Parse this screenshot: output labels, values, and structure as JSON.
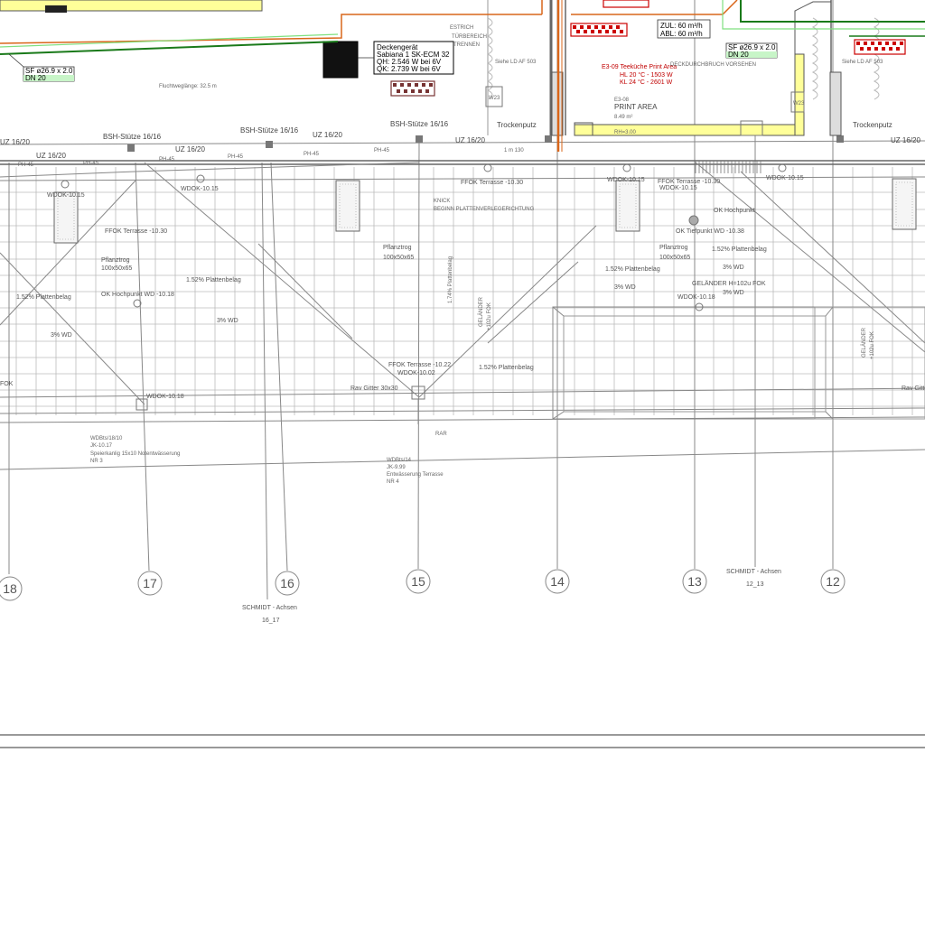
{
  "annotations": {
    "sf_left": "SF ø26.9 x 2.0",
    "dn_left": "DN 20",
    "sf_right": "SF ø26.9 x 2.0",
    "dn_right": "DN 20",
    "fluchtweglaenge": "Fluchtweglänge: 32.5 m",
    "estrich": "ESTRICH",
    "tuerbereich": "TÜRBEREICH",
    "trennen": "TRENNEN",
    "siehe_left": "Siehe LD AF 503",
    "siehe_right": "Siehe LD AF 503",
    "deckengeraet_1": "Deckengerät",
    "deckengeraet_2": "Sabiana 1 SK-ECM 32",
    "deckengeraet_3": "QH: 2.546 W bei 6V",
    "deckengeraet_4": "QK: 2.739 W bei 6V",
    "zul": "ZUL: 60 m³/h",
    "abl": "ABL: 60 m³/h",
    "teekueche_1": "E3-09 Teeküche Print Area",
    "teekueche_2": "HL 20 °C - 1503 W",
    "teekueche_3": "KL 24 °C - 2601 W",
    "deckdurchbruch": "DECKDURCHBRUCH VORSEHEN",
    "room_no": "E3-08",
    "room_name": "PRINT AREA",
    "room_area": "8.49 m²",
    "room_rh": "RH=3.00",
    "trockenputz_left": "Trockenputz",
    "trockenputz_right": "Trockenputz",
    "w23_left": "W23",
    "w23_right": "W23",
    "bsh_1": "BSH-Stütze 16/16",
    "bsh_2": "BSH-Stütze 16/16",
    "bsh_3": "BSH-Stütze 16/16",
    "uz_1": "UZ 16/20",
    "uz_2": "UZ 16/20",
    "uz_3": "UZ 16/20",
    "uz_4": "UZ 16/20",
    "uz_5": "UZ 16/20",
    "uz_6": "UZ 16/20",
    "ph45": "PH-45",
    "wdok_1015": "WDOK-10.15",
    "ffok_1030": "FFOK Terrasse -10.30",
    "knick": "KNICK",
    "beginn": "BEGINN PLATTENVERLEGERICHTUNG",
    "pflanztrog": "Pflanztrog",
    "pflanztrog_dim": "100x50x65",
    "gefaelle_152": "1.52% Plattenbelag",
    "gefaelle_174": "1.74% Plattenbelag",
    "wd_3": "3% WD",
    "ok_tiefpunkt": "OK Tiefpunkt WD -10.38",
    "ok_hochpunkt": "OK Hochpunkt WD -10.18",
    "ok_hochpunkt_short": "OK Hochpunkt",
    "wdok_1018": "WDOK-10.18",
    "ffok_1022": "FFOK Terrasse -10.22",
    "wdok_1002": "WDOK-10.02",
    "rav_gitter": "Rav Gitter 30x30",
    "rar": "RAR",
    "gelaender": "GELÄNDER",
    "gelaender_ok": "GELÄNDER H=102u FOK",
    "gelaender_short": "+102u FOK",
    "wd_1": "WDBts/18/10",
    "wd_2": "JK-10.17",
    "wd_3b": "Speierkanlig 15x10 Notentwässerung",
    "wd_4": "NR 3",
    "wd2_1": "WDBts/14",
    "wd2_2": "JK-9.99",
    "wd2_3": "Entwässerung Terrasse",
    "wd2_4": "NR 4",
    "dim_130": "1 m 130",
    "schmidt_axes_left_1": "SCHMIDT - Achsen",
    "schmidt_axes_left_2": "16_17",
    "schmidt_axes_right_1": "SCHMIDT - Achsen",
    "schmidt_axes_right_2": "12_13",
    "axes": [
      "18",
      "17",
      "16",
      "15",
      "14",
      "13",
      "12"
    ]
  },
  "colors": {
    "green_pipe": "#1a7a1a",
    "light_green_pipe": "#7fe07f",
    "orange_pipe": "#d9661a",
    "yellow_fill": "#ffff99",
    "red_text": "#cc0000",
    "grid": "#bbbbbb"
  }
}
